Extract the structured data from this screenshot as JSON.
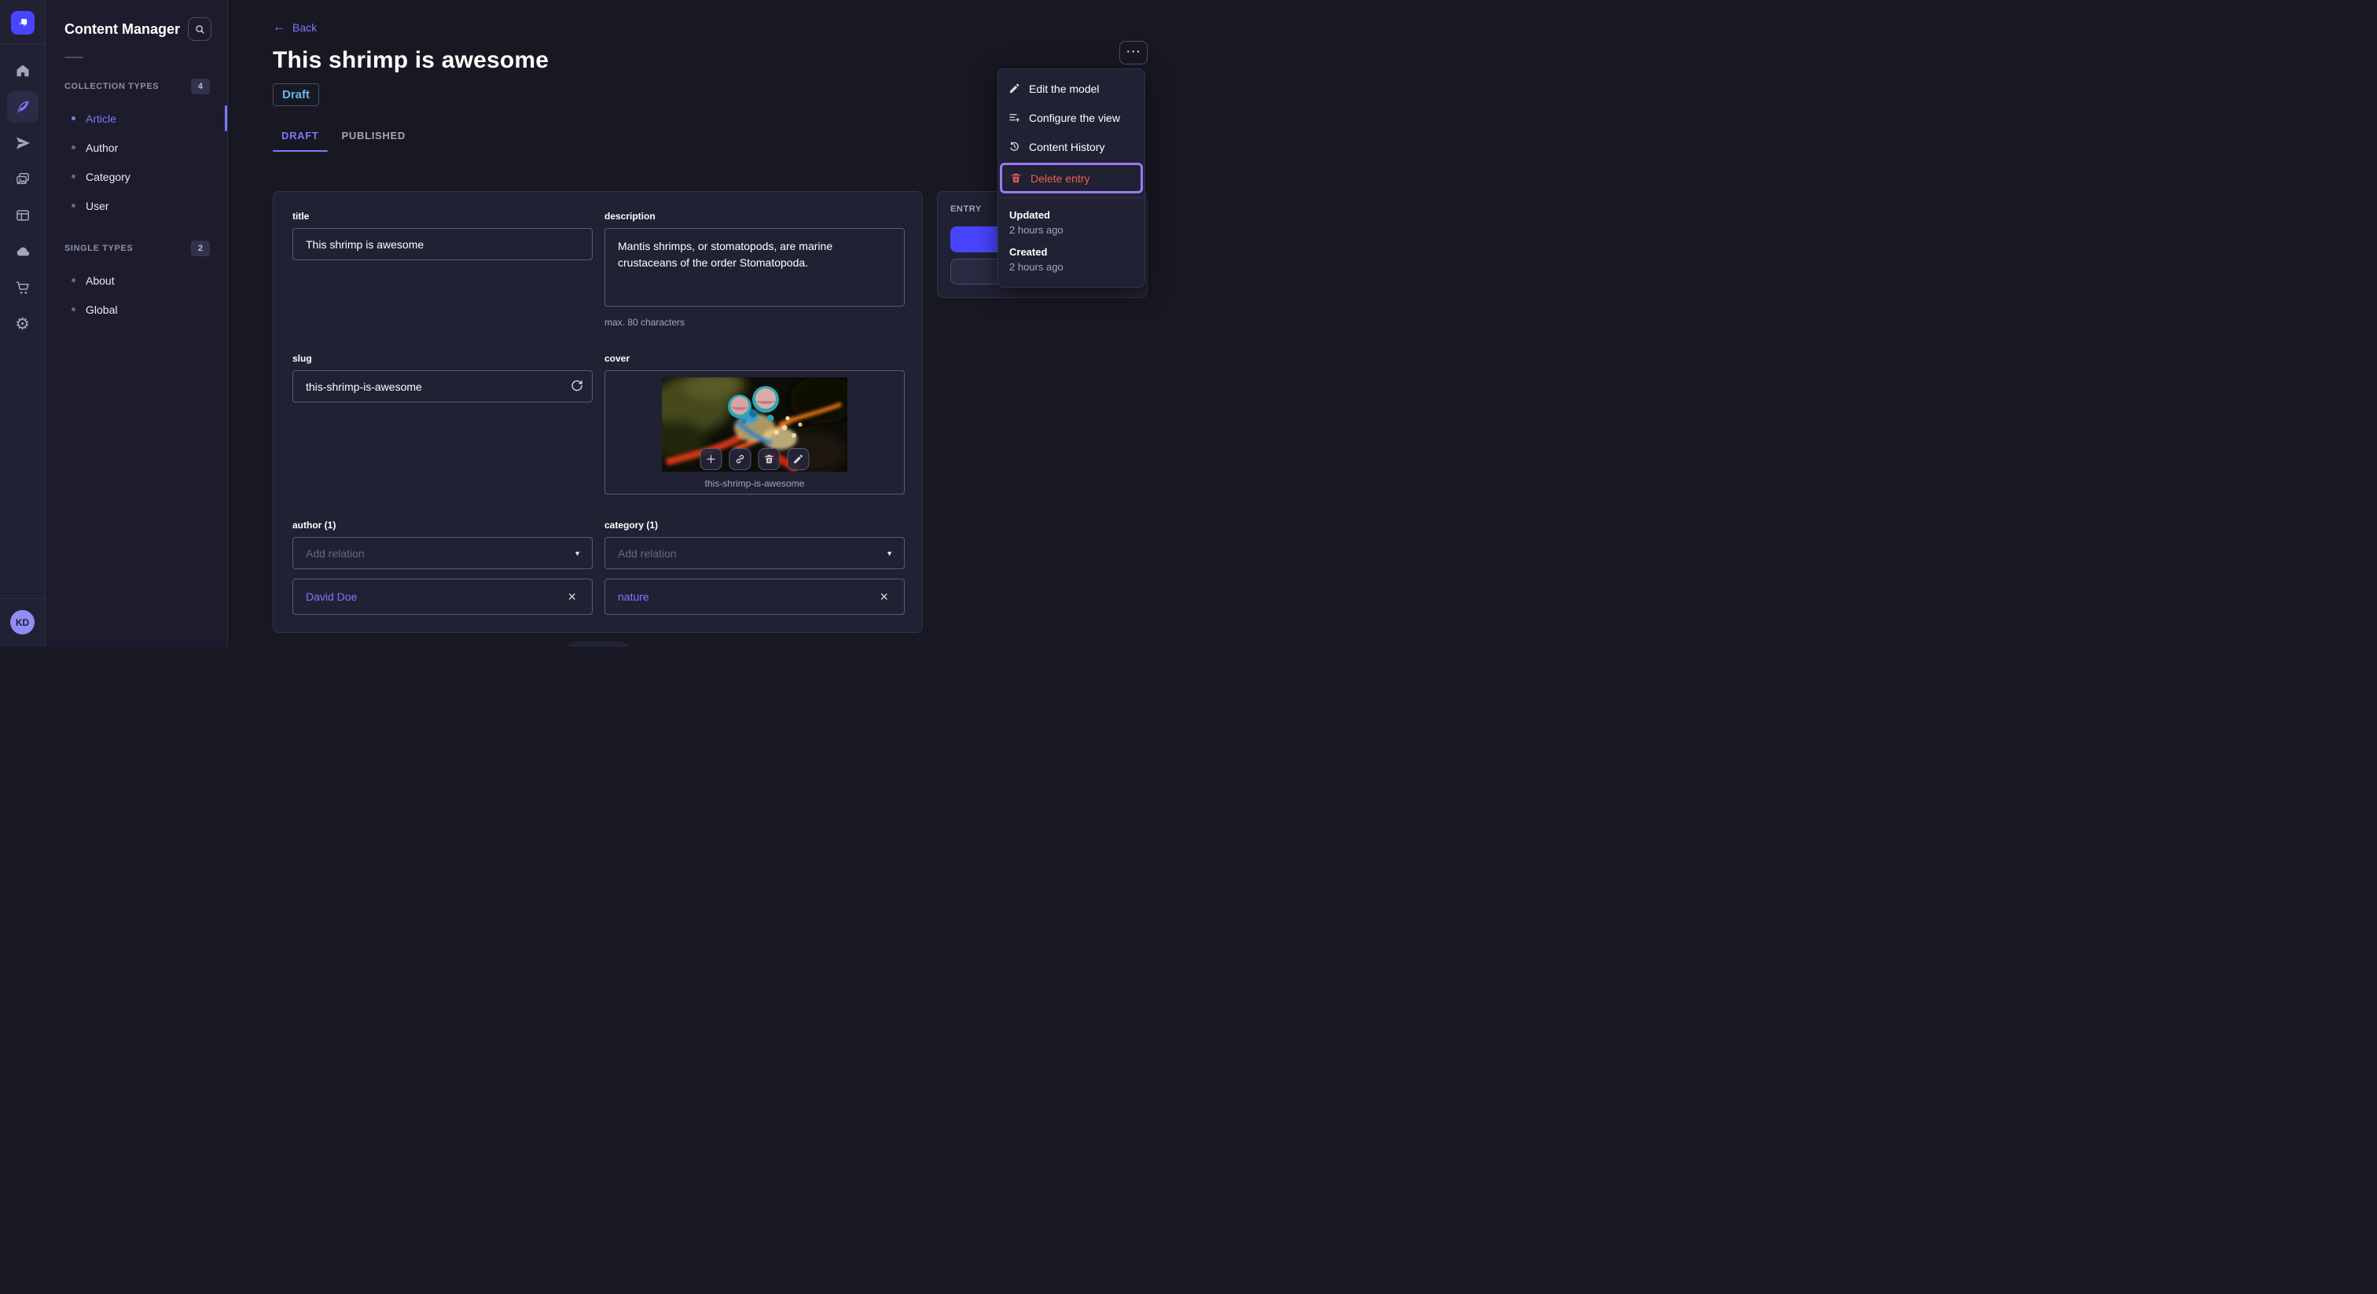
{
  "colors": {
    "primary": "#4945ff",
    "link": "#7b79ff",
    "danger": "#ee5e52",
    "highlight_outline": "#9b79f1",
    "status_draft_text": "#66b7f1",
    "card_bg": "#212134",
    "app_bg": "#181822"
  },
  "iconbar": {
    "avatar_initials": "KD"
  },
  "subnav": {
    "title": "Content Manager",
    "groups": [
      {
        "label": "COLLECTION TYPES",
        "count": "4",
        "items": [
          {
            "label": "Article",
            "active": true
          },
          {
            "label": "Author",
            "active": false
          },
          {
            "label": "Category",
            "active": false
          },
          {
            "label": "User",
            "active": false
          }
        ]
      },
      {
        "label": "SINGLE TYPES",
        "count": "2",
        "items": [
          {
            "label": "About",
            "active": false
          },
          {
            "label": "Global",
            "active": false
          }
        ]
      }
    ]
  },
  "header": {
    "back_label": "Back",
    "back_arrow": "←",
    "title": "This shrimp is awesome",
    "status_badge": "Draft",
    "tabs": [
      {
        "label": "DRAFT",
        "active": true
      },
      {
        "label": "PUBLISHED",
        "active": false
      }
    ],
    "more_label": "···"
  },
  "form": {
    "title": {
      "label": "title",
      "value": "This shrimp is awesome"
    },
    "description": {
      "label": "description",
      "value": "Mantis shrimps, or stomatopods, are marine crustaceans of the order Stomatopoda.",
      "hint": "max. 80 characters"
    },
    "slug": {
      "label": "slug",
      "value": "this-shrimp-is-awesome"
    },
    "cover": {
      "label": "cover",
      "filename": "this-shrimp-is-awesome"
    },
    "author": {
      "label": "author (1)",
      "placeholder": "Add relation",
      "relation": "David Doe",
      "chevron": "▼",
      "remove": "×"
    },
    "category": {
      "label": "category (1)",
      "placeholder": "Add relation",
      "relation": "nature",
      "chevron": "▼",
      "remove": "×"
    }
  },
  "entry_panel": {
    "title": "ENTRY"
  },
  "context_menu": {
    "items": [
      {
        "label": "Edit the model"
      },
      {
        "label": "Configure the view"
      },
      {
        "label": "Content History"
      },
      {
        "label": "Delete entry"
      }
    ],
    "meta": [
      {
        "label": "Updated",
        "value": "2 hours ago"
      },
      {
        "label": "Created",
        "value": "2 hours ago"
      }
    ]
  }
}
